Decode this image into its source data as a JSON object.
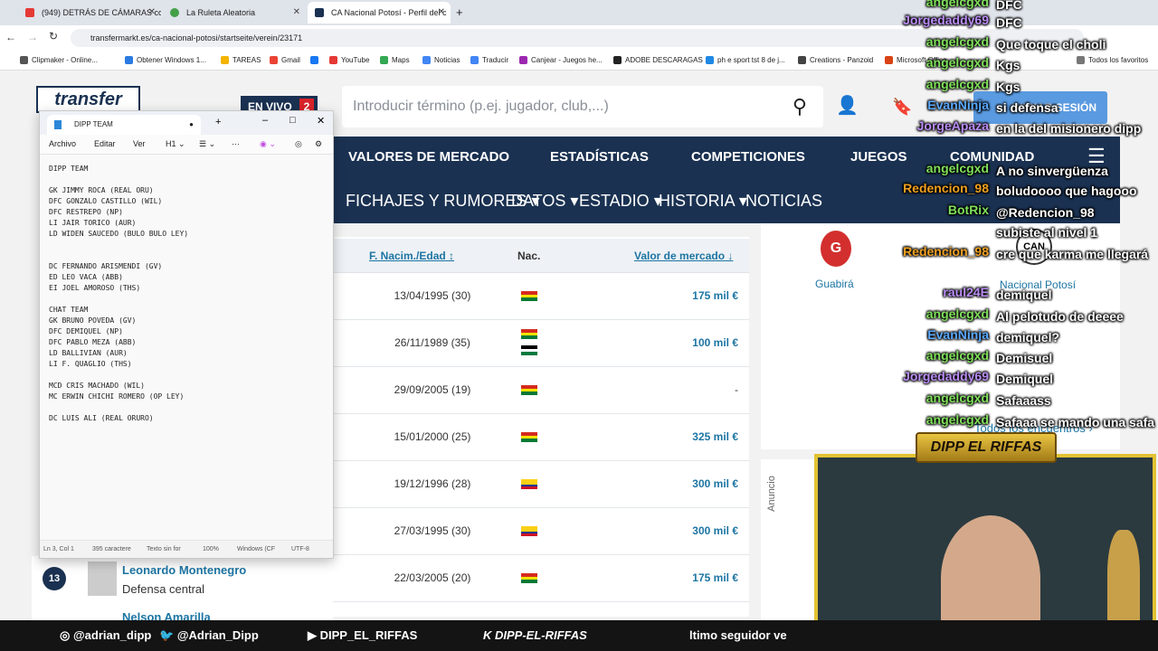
{
  "browser": {
    "tabs": [
      {
        "label": "(949) DETRÁS DE CÁMARAS co",
        "color": "#e53935"
      },
      {
        "label": "La Ruleta Aleatoria",
        "color": "#43a047"
      },
      {
        "label": "CA Nacional Potosí - Perfil del c",
        "color": "#1a3151"
      }
    ],
    "url": "transfermarkt.es/ca-nacional-potosi/startseite/verein/23171",
    "bookmarks": [
      "Clipmaker - Online...",
      "Obtener Windows 1...",
      "TAREAS",
      "Gmail",
      "YouTube",
      "Maps",
      "Noticias",
      "Traducir",
      "Canjear - Juegos he...",
      "ADOBE DESCARAGAS",
      "ph e sport tst 8 de j...",
      "Creations - Panzoid",
      "Microsoft Office",
      "Todos los favoritos"
    ]
  },
  "site": {
    "logo": "transfer",
    "live_label": "EN VIVO",
    "live_count": "2",
    "search_placeholder": "Introducir término (p.ej. jugador, club,...)",
    "login_label": "INICIAR SESIÓN",
    "nav_top": [
      "VALORES DE MERCADO",
      "ESTADÍSTICAS",
      "COMPETICIONES",
      "JUEGOS",
      "COMUNIDAD"
    ],
    "nav_sub": [
      "FICHAJES Y RUMORES",
      "DATOS",
      "ESTADIO",
      "HISTORIA",
      "NOTICIAS"
    ],
    "table": {
      "headers": [
        "F. Nacim./Edad",
        "Nac.",
        "Valor de mercado"
      ],
      "rows": [
        {
          "date": "13/04/1995 (30)",
          "value": "175 mil €"
        },
        {
          "date": "26/11/1989 (35)",
          "value": "100 mil €"
        },
        {
          "date": "29/09/2005 (19)",
          "value": "-"
        },
        {
          "date": "15/01/2000 (25)",
          "value": "325 mil €"
        },
        {
          "date": "19/12/1996 (28)",
          "value": "300 mil €"
        },
        {
          "date": "27/03/1995 (30)",
          "value": "300 mil €"
        },
        {
          "date": "22/03/2005 (20)",
          "value": "175 mil €"
        }
      ]
    },
    "player": {
      "number": "13",
      "name": "Leonardo Montenegro",
      "position": "Defensa central",
      "next_name": "Nelson Amarilla"
    },
    "match": {
      "home": "Guabirá",
      "away": "Nacional Potosí",
      "all_matches": "Todos los encuentros"
    },
    "ad_label": "Anuncio"
  },
  "notepad": {
    "tab_title": "DIPP TEAM",
    "menu": [
      "Archivo",
      "Editar",
      "Ver",
      "H1"
    ],
    "lines": [
      "DIPP TEAM",
      "",
      "GK JIMMY ROCA (REAL ORU)",
      "DFC GONZALO CASTILLO (WIL)",
      "DFC RESTREPO (NP)",
      "LI JAIR TORICO (AUR)",
      "LD WIDEN SAUCEDO (BULO BULO LEY)",
      "",
      "",
      "DC FERNANDO ARISMENDI (GV)",
      "ED LEO VACA (ABB)",
      "EI JOEL AMOROSO (THS)",
      "",
      "CHAT TEAM",
      "GK BRUNO POVEDA (GV)",
      "DFC DEMIQUEL (NP)",
      "DFC PABLO MEZA (ABB)",
      "LD BALLIVIAN (AUR)",
      "LI F. QUAGLIO (THS)",
      "",
      "MCD CRIS MACHADO (WIL)",
      "MC ERWIN CHICHI ROMERO (OP LEY)",
      "",
      "DC LUIS ALI (REAL ORURO)"
    ],
    "status": [
      "Ln 3, Col 1",
      "395 caractere",
      "Texto sin for",
      "100%",
      "Windows (CF",
      "UTF-8"
    ]
  },
  "chat": [
    {
      "user": "angelcgxd",
      "msg": "DFC",
      "color": "#7fe05a"
    },
    {
      "user": "Jorgedaddy69",
      "msg": "DFC",
      "color": "#b98cf5"
    },
    {
      "user": "angelcgxd",
      "msg": "Que toque el choli",
      "color": "#7fe05a"
    },
    {
      "user": "angelcgxd",
      "msg": "Kgs",
      "color": "#7fe05a"
    },
    {
      "user": "angelcgxd",
      "msg": "Kgs",
      "color": "#7fe05a"
    },
    {
      "user": "EvanNinja",
      "msg": "si defensa",
      "color": "#5aa9ff"
    },
    {
      "user": "JorgeApaza",
      "msg": "en la del misionero dipp",
      "color": "#b98cf5"
    },
    {
      "user": "angelcgxd",
      "msg": "A no sinvergüenza",
      "color": "#7fe05a"
    },
    {
      "user": "Redencion_98",
      "msg": "boludoooo que hagooo",
      "color": "#f0a020"
    },
    {
      "user": "BotRix",
      "msg": "@Redencion_98",
      "color": "#7fe05a"
    },
    {
      "user": "",
      "msg": "subiste al nivel 1",
      "color": "#ffffff"
    },
    {
      "user": "Redencion_98",
      "msg": "cre que karma me llegará",
      "color": "#f0a020"
    },
    {
      "user": "raul24E",
      "msg": "demiquel",
      "color": "#b98cf5"
    },
    {
      "user": "angelcgxd",
      "msg": "Al pelotudo de deeee",
      "color": "#7fe05a"
    },
    {
      "user": "EvanNinja",
      "msg": "demiquel?",
      "color": "#5aa9ff"
    },
    {
      "user": "angelcgxd",
      "msg": "Demisuel",
      "color": "#7fe05a"
    },
    {
      "user": "Jorgedaddy69",
      "msg": "Demiquel",
      "color": "#b98cf5"
    },
    {
      "user": "angelcgxd",
      "msg": "Safaaass",
      "color": "#7fe05a"
    },
    {
      "user": "angelcgxd",
      "msg": "Safaaa se mando una safa",
      "color": "#7fe05a"
    }
  ],
  "stream": {
    "cam_title": "DIPP EL RIFFAS",
    "ticker": [
      "@adrian_dipp",
      "@Adrian_Dipp",
      "DIPP_EL_RIFFAS",
      "DIPP-EL-RIFFAS",
      "ltimo seguidor ve"
    ]
  }
}
